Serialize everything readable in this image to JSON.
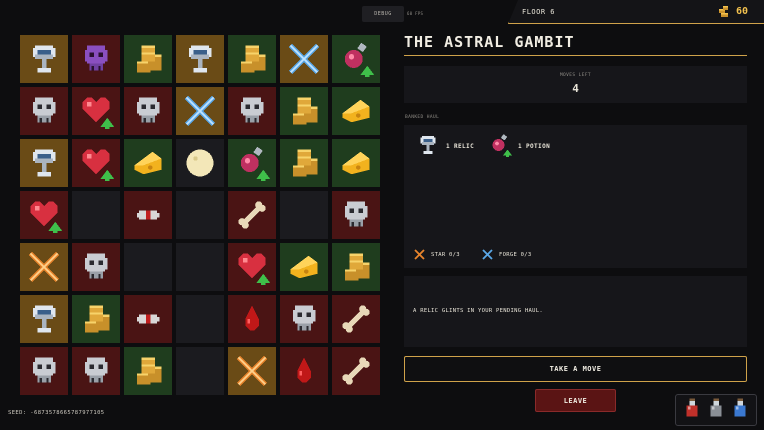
{
  "header": {
    "debug_label": "DEBUG",
    "fps_label": "60 FPS",
    "floor_label": "FLOOR 6",
    "coins": "60",
    "coin_icon": "coin-stack-icon"
  },
  "board": {
    "rows": 7,
    "cols": 7,
    "cells": [
      [
        {
          "bg": "gold",
          "icon": "chalice"
        },
        {
          "bg": "red",
          "icon": "skull-purple"
        },
        {
          "bg": "green",
          "icon": "coins"
        },
        {
          "bg": "gold",
          "icon": "chalice"
        },
        {
          "bg": "green",
          "icon": "coins"
        },
        {
          "bg": "gold",
          "icon": "forge-x"
        },
        {
          "bg": "green",
          "icon": "potion-up"
        }
      ],
      [
        {
          "bg": "red",
          "icon": "skull"
        },
        {
          "bg": "red",
          "icon": "heart-up"
        },
        {
          "bg": "red",
          "icon": "skull"
        },
        {
          "bg": "gold",
          "icon": "forge-x"
        },
        {
          "bg": "red",
          "icon": "skull"
        },
        {
          "bg": "green",
          "icon": "coins"
        },
        {
          "bg": "green",
          "icon": "cheese"
        }
      ],
      [
        {
          "bg": "gold",
          "icon": "chalice"
        },
        {
          "bg": "red",
          "icon": "heart-up"
        },
        {
          "bg": "green",
          "icon": "cheese"
        },
        {
          "bg": "dark",
          "icon": "moon"
        },
        {
          "bg": "green",
          "icon": "potion-up"
        },
        {
          "bg": "green",
          "icon": "coins"
        },
        {
          "bg": "green",
          "icon": "cheese"
        }
      ],
      [
        {
          "bg": "red",
          "icon": "heart-up"
        },
        {
          "bg": "dark",
          "icon": ""
        },
        {
          "bg": "red",
          "icon": "eye"
        },
        {
          "bg": "dark",
          "icon": ""
        },
        {
          "bg": "red",
          "icon": "bone"
        },
        {
          "bg": "dark",
          "icon": ""
        },
        {
          "bg": "red",
          "icon": "skull"
        }
      ],
      [
        {
          "bg": "gold",
          "icon": "star-x"
        },
        {
          "bg": "red",
          "icon": "skull"
        },
        {
          "bg": "dark",
          "icon": ""
        },
        {
          "bg": "dark",
          "icon": ""
        },
        {
          "bg": "red",
          "icon": "heart-up"
        },
        {
          "bg": "green",
          "icon": "cheese"
        },
        {
          "bg": "green",
          "icon": "coins"
        }
      ],
      [
        {
          "bg": "gold",
          "icon": "chalice"
        },
        {
          "bg": "green",
          "icon": "coins"
        },
        {
          "bg": "red",
          "icon": "eye"
        },
        {
          "bg": "dark",
          "icon": ""
        },
        {
          "bg": "red",
          "icon": "blood"
        },
        {
          "bg": "red",
          "icon": "skull"
        },
        {
          "bg": "red",
          "icon": "bone"
        }
      ],
      [
        {
          "bg": "red",
          "icon": "skull"
        },
        {
          "bg": "red",
          "icon": "skull"
        },
        {
          "bg": "green",
          "icon": "coins"
        },
        {
          "bg": "dark",
          "icon": ""
        },
        {
          "bg": "gold",
          "icon": "star-x"
        },
        {
          "bg": "red",
          "icon": "blood"
        },
        {
          "bg": "red",
          "icon": "bone"
        }
      ]
    ]
  },
  "seed_text": "SEED: -6873578665787977105",
  "panel": {
    "title": "THE ASTRAL GAMBIT",
    "moves_label": "MOVES LEFT",
    "moves_value": "4",
    "haul_label": "BANKED HAUL",
    "haul_items": [
      {
        "label": "1 RELIC",
        "icon": "chalice"
      },
      {
        "label": "1 POTION",
        "icon": "potion-up"
      }
    ],
    "progress": [
      {
        "label": "STAR 0/3",
        "icon": "star-x",
        "color": "#e8842c"
      },
      {
        "label": "FORGE 0/3",
        "icon": "forge-x",
        "color": "#5aa8e8"
      }
    ],
    "message": "A RELIC GLINTS IN YOUR PENDING HAUL.",
    "take_button": "TAKE A MOVE",
    "leave_button": "LEAVE"
  },
  "potion_tray": [
    {
      "icon": "red-potion-icon",
      "color": "#c0302a"
    },
    {
      "icon": "gray-potion-icon",
      "color": "#8a8f96"
    },
    {
      "icon": "blue-potion-icon",
      "color": "#3a78d0"
    }
  ]
}
